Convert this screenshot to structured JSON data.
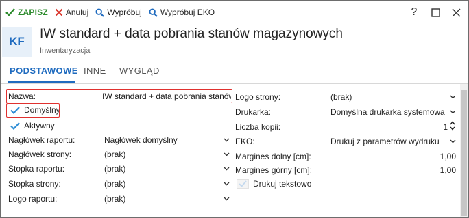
{
  "toolbar": {
    "save_label": "ZAPISZ",
    "cancel_label": "Anuluj",
    "try_label": "Wypróbuj",
    "try_eko_label": "Wypróbuj EKO",
    "help_label": "?"
  },
  "header": {
    "badge": "KF",
    "title": "IW standard + data pobrania stanów magazynowych",
    "subtitle": "Inwentaryzacja"
  },
  "tabs": [
    "PODSTAWOWE",
    "INNE",
    "WYGLĄD"
  ],
  "form": {
    "nazwa_label": "Nazwa:",
    "nazwa_value": "IW standard + data pobrania stanów m",
    "domyslny_label": "Domyślny",
    "aktywny_label": "Aktywny",
    "naglowek_raportu_label": "Nagłówek raportu:",
    "naglowek_raportu_value": "Nagłówek domyślny",
    "naglowek_strony_label": "Nagłówek strony:",
    "naglowek_strony_value": "(brak)",
    "stopka_raportu_label": "Stopka raportu:",
    "stopka_raportu_value": "(brak)",
    "stopka_strony_label": "Stopka strony:",
    "stopka_strony_value": "(brak)",
    "logo_raportu_label": "Logo raportu:",
    "logo_raportu_value": "(brak)",
    "logo_strony_label": "Logo strony:",
    "logo_strony_value": "(brak)",
    "drukarka_label": "Drukarka:",
    "drukarka_value": "Domyślna drukarka systemowa",
    "liczba_kopii_label": "Liczba kopii:",
    "liczba_kopii_value": "1",
    "eko_label": "EKO:",
    "eko_value": "Drukuj z parametrów wydruku",
    "margines_dolny_label": "Margines dolny [cm]:",
    "margines_dolny_value": "1,00",
    "margines_gorny_label": "Margines górny [cm]:",
    "margines_gorny_value": "1,00",
    "drukuj_tekstowo_label": "Drukuj tekstowo"
  },
  "colors": {
    "accent": "#1f6bbf",
    "save": "#2b8a2b",
    "cancel": "#d9342b",
    "highlight": "#e0312f"
  }
}
